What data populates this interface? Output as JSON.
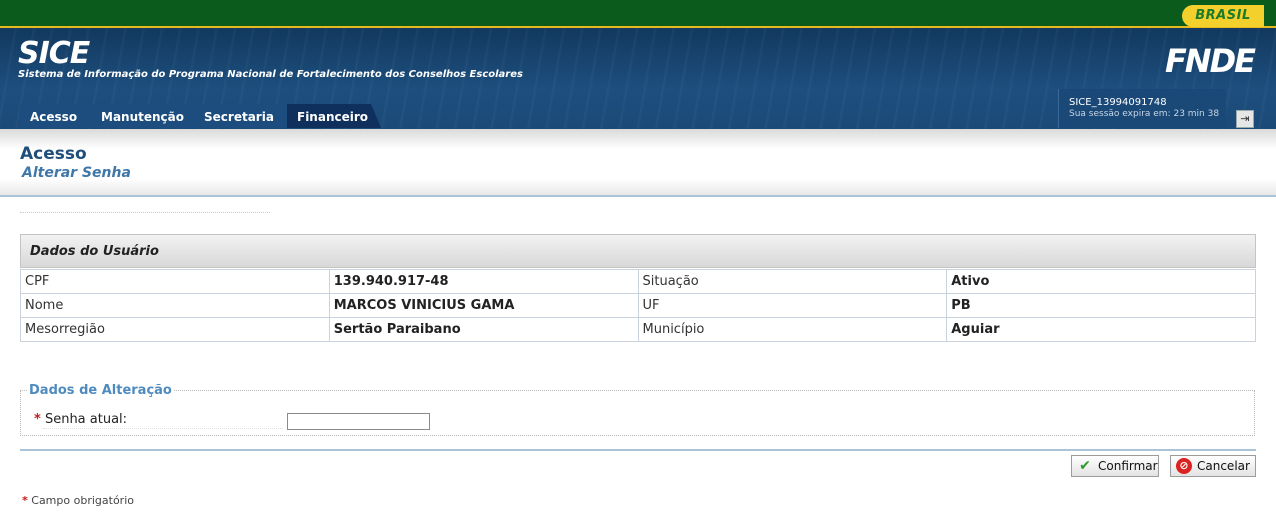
{
  "gov_bar": {
    "brand": "BRASIL"
  },
  "header": {
    "app_name": "SICE",
    "app_subtitle": "Sistema de Informação do Programa Nacional de Fortalecimento dos Conselhos Escolares",
    "logo": "FNDE"
  },
  "tabs": [
    {
      "label": "Acesso"
    },
    {
      "label": "Manutenção"
    },
    {
      "label": "Secretaria"
    },
    {
      "label": "Financeiro",
      "active": true
    }
  ],
  "session": {
    "id": "SICE_13994091748",
    "expires": "Sua sessão expira em: 23 min 38"
  },
  "page": {
    "title": "Acesso",
    "subtitle": "Alterar Senha"
  },
  "user_panel": {
    "title": "Dados do Usuário",
    "rows": [
      {
        "l1": "CPF",
        "v1": "139.940.917-48",
        "l2": "Situação",
        "v2": "Ativo"
      },
      {
        "l1": "Nome",
        "v1": "MARCOS VINICIUS GAMA",
        "l2": "UF",
        "v2": "PB"
      },
      {
        "l1": "Mesorregião",
        "v1": "Sertão Paraibano",
        "l2": "Município",
        "v2": "Aguiar"
      }
    ]
  },
  "change_form": {
    "legend": "Dados de Alteração",
    "required_mark": "*",
    "current_password_label": "Senha atual:",
    "current_password_value": ""
  },
  "buttons": {
    "confirm": "Confirmar",
    "cancel": "Cancelar"
  },
  "footnote": {
    "mark": "*",
    "text": "Campo obrigatório"
  },
  "colors": {
    "gov_green": "#0a5b1c",
    "header_blue": "#1d4e7d",
    "title_blue": "#1f4e7a",
    "required_red": "#c31c1c"
  }
}
